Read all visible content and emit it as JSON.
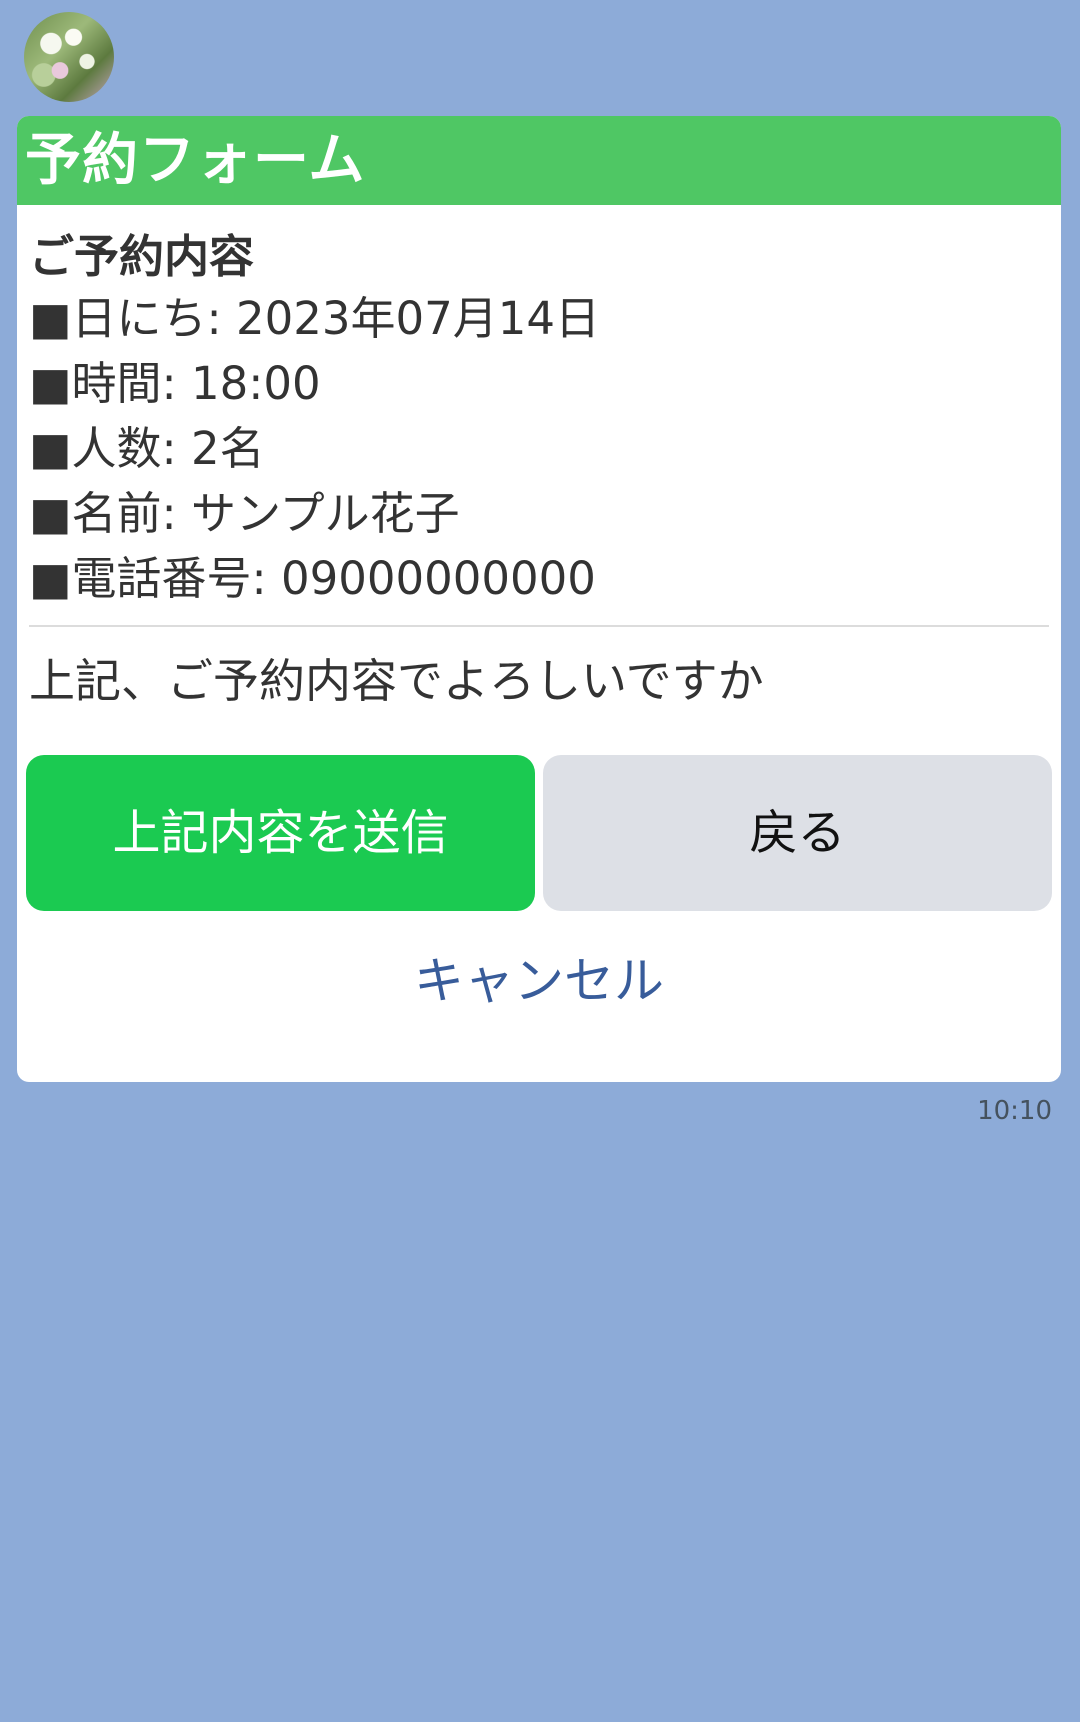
{
  "message": {
    "time": "10:10"
  },
  "card": {
    "header": "予約フォーム",
    "section_title": "ご予約内容",
    "details": [
      "■日にち: 2023年07月14日",
      "■時間: 18:00",
      "■人数: 2名",
      "■名前: サンプル花子",
      "■電話番号: 09000000000"
    ],
    "confirm_text": "上記、ご予約内容でよろしいですか",
    "submit_label": "上記内容を送信",
    "back_label": "戻る",
    "cancel_label": "キャンセル"
  },
  "colors": {
    "background": "#8dabd8",
    "header": "#4fc764",
    "submit_button": "#1bca51",
    "back_button": "#dde0e6",
    "cancel_link": "#385c9a"
  }
}
